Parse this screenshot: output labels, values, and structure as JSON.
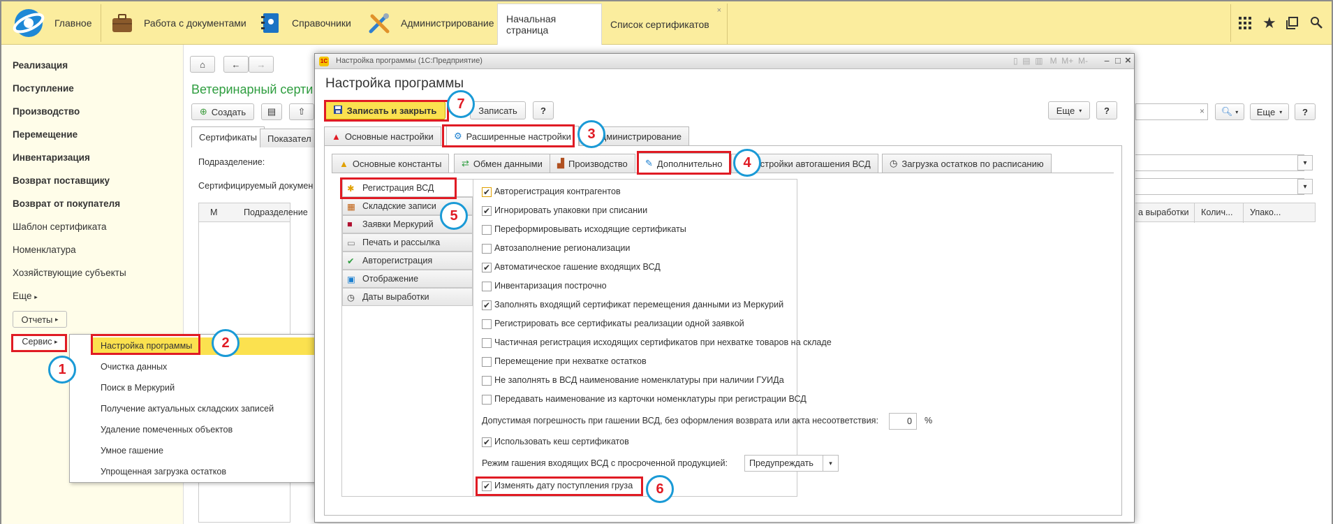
{
  "topbar": {
    "sections": [
      {
        "label": "Главное",
        "icon": "logo-icon"
      },
      {
        "label": "Работа с документами",
        "icon": "briefcase-icon"
      },
      {
        "label": "Справочники",
        "icon": "book-icon"
      },
      {
        "label": "Администрирование",
        "icon": "tools-icon"
      }
    ],
    "tabs": [
      {
        "label": "Начальная страница",
        "active": true
      },
      {
        "label": "Список сертификатов",
        "active": false,
        "close": "×"
      }
    ]
  },
  "sidebar": {
    "items": [
      {
        "label": "Реализация",
        "bold": true
      },
      {
        "label": "Поступление",
        "bold": true
      },
      {
        "label": "Производство",
        "bold": true
      },
      {
        "label": "Перемещение",
        "bold": true
      },
      {
        "label": "Инвентаризация",
        "bold": true
      },
      {
        "label": "Возврат поставщику",
        "bold": true
      },
      {
        "label": "Возврат от покупателя",
        "bold": true
      },
      {
        "label": "Шаблон сертификата",
        "bold": false
      },
      {
        "label": "Номенклатура",
        "bold": false
      },
      {
        "label": "Хозяйствующие субъекты",
        "bold": false
      },
      {
        "label": "Еще",
        "bold": false
      }
    ],
    "reports_label": "Отчеты",
    "service_label": "Сервис"
  },
  "service_menu": {
    "items": [
      "Настройка программы",
      "Очистка данных",
      "Поиск в Меркурий",
      "Получение актуальных складских записей",
      "Удаление помеченных объектов",
      "Умное гашение",
      "Упрощенная загрузка остатков"
    ]
  },
  "main": {
    "title": "Ветеринарный серти",
    "create_label": "Создать",
    "tabs": [
      "Сертификаты",
      "Показател"
    ],
    "field1_label": "Подразделение:",
    "field2_label": "Сертифицируемый докумен",
    "columns_left": [
      "М",
      "Подразделение"
    ],
    "columns_right": [
      "а выработки",
      "Колич...",
      "Упако..."
    ],
    "more_label": "Еще",
    "help_label": "?",
    "search_clear": "×"
  },
  "dialog": {
    "window_title": "Настройка программы  (1С:Предприятие)",
    "title": "Настройка программы",
    "save_close_label": "Записать и закрыть",
    "save_label": "Записать",
    "help_label": "?",
    "more_label": "Еще",
    "tabs": [
      "Основные настройки",
      "Расширенные настройки",
      "Администрирование"
    ],
    "subtabs": [
      "Основные константы",
      "Обмен данными",
      "Производство",
      "Дополнительно",
      "Настройки автогашения ВСД",
      "Загрузка остатков по расписанию"
    ],
    "nav": [
      "Регистрация ВСД",
      "Складские записи",
      "Заявки Меркурий",
      "Печать и рассылка",
      "Авторегистрация",
      "Отображение",
      "Даты выработки"
    ],
    "checkboxes": [
      {
        "label": "Авторегистрация контрагентов",
        "checked": true
      },
      {
        "label": "Игнорировать упаковки при списании",
        "checked": true
      },
      {
        "label": "Переформировывать исходящие сертификаты",
        "checked": false
      },
      {
        "label": "Автозаполнение регионализации",
        "checked": false
      },
      {
        "label": "Автоматическое гашение входящих ВСД",
        "checked": true
      },
      {
        "label": "Инвентаризация построчно",
        "checked": false
      },
      {
        "label": "Заполнять входящий сертификат перемещения данными из Меркурий",
        "checked": true
      },
      {
        "label": "Регистрировать все сертификаты реализации одной заявкой",
        "checked": false
      },
      {
        "label": "Частичная регистрация исходящих сертификатов при нехватке товаров на складе",
        "checked": false
      },
      {
        "label": "Перемещение при нехватке остатков",
        "checked": false
      },
      {
        "label": "Не заполнять в ВСД наименование номенклатуры при наличии ГУИДа",
        "checked": false
      },
      {
        "label": "Передавать наименование из карточки номенклатуры при регистрации ВСД",
        "checked": false
      }
    ],
    "tolerance_label": "Допустимая погрешность при гашении ВСД, без оформления возврата или акта несоответствия:",
    "tolerance_value": "0",
    "tolerance_unit": "%",
    "cache_label": "Использовать кеш сертификатов",
    "cache_checked": true,
    "expired_label": "Режим гашения входящих ВСД с просроченной продукцией:",
    "expired_value": "Предупреждать",
    "change_date_label": "Изменять дату поступления груза",
    "change_date_checked": true,
    "check_mark": "✔"
  },
  "annotations": [
    "1",
    "2",
    "3",
    "4",
    "5",
    "6",
    "7"
  ],
  "colors": {
    "topbar": "#fbed9e",
    "sidebar": "#fffde9",
    "highlight": "#fbe14f",
    "red": "#e01b24",
    "blue": "#1a9ad6",
    "green_title": "#2e9d3f"
  }
}
